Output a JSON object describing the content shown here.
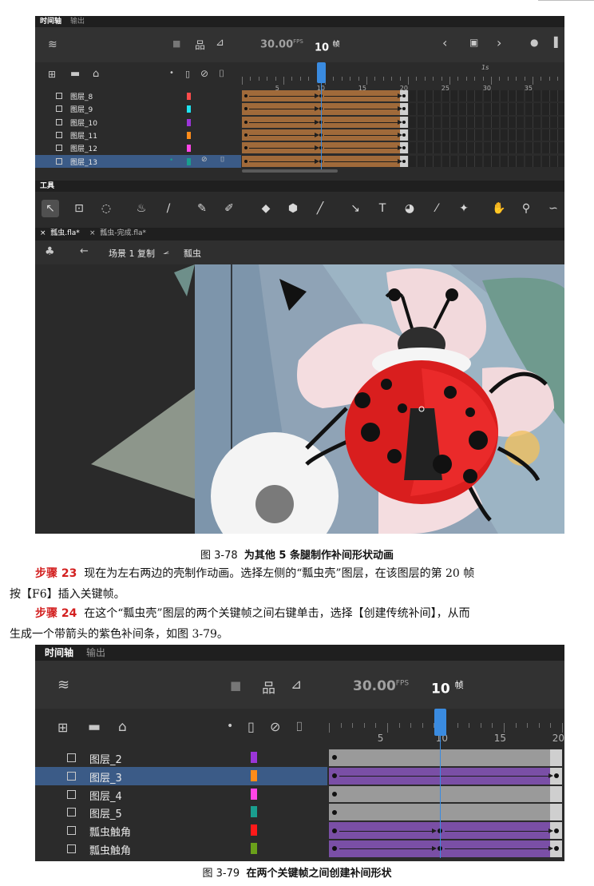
{
  "screen1": {
    "tabs": [
      "时间轴",
      "输出"
    ],
    "fps_value": "30.00",
    "fps_unit": "FPS",
    "frame_value": "10",
    "frame_unit": "帧",
    "ruler_second_label": "1s",
    "ruler_labels": [
      "5",
      "10",
      "15",
      "20",
      "25",
      "30",
      "35"
    ],
    "layers": [
      {
        "name": "图层_8",
        "color": "#ff4b4b"
      },
      {
        "name": "图层_9",
        "color": "#1ee3f0"
      },
      {
        "name": "图层_10",
        "color": "#9b35d8"
      },
      {
        "name": "图层_11",
        "color": "#ff8c1a"
      },
      {
        "name": "图层_12",
        "color": "#ff45e6"
      },
      {
        "name": "图层_13",
        "color": "#1a9e8e"
      }
    ],
    "tools_label": "工具",
    "doc_tabs": [
      "瓢虫.fla*",
      "瓢虫-完成.fla*"
    ],
    "breadcrumb": {
      "scene": "场景 1 复制",
      "symbol": "瓢虫"
    }
  },
  "caption1": {
    "number": "图 3-78",
    "text": "为其他 5 条腿制作补间形状动画"
  },
  "step23": {
    "label": "步骤 23",
    "line1": "现在为左右两边的壳制作动画。选择左侧的“瓢虫壳”图层，在该图层的第 20 帧",
    "line2": "按【F6】插入关键帧。"
  },
  "step24": {
    "label": "步骤 24",
    "line1": "在这个“瓢虫壳”图层的两个关键帧之间右键单击，选择【创建传统补间】，从而",
    "line2": "生成一个带箭头的紫色补间条，如图 3-79。"
  },
  "screen2": {
    "tabs": [
      "时间轴",
      "输出"
    ],
    "fps_value": "30.00",
    "fps_unit": "FPS",
    "frame_value": "10",
    "frame_unit": "帧",
    "ruler_labels": [
      "5",
      "10",
      "15",
      "20"
    ],
    "layers": [
      {
        "name": "图层_2",
        "color": "#9b35d8",
        "tween": false
      },
      {
        "name": "图层_3",
        "color": "#ff8c1a",
        "tween": true
      },
      {
        "name": "图层_4",
        "color": "#ff45e6",
        "tween": false
      },
      {
        "name": "图层_5",
        "color": "#1a9e8e",
        "tween": false
      },
      {
        "name": "瓢虫触角",
        "color": "#ff1a1a",
        "tween": true
      },
      {
        "name": "瓢虫触角",
        "color": "#6aa01a",
        "tween": true
      }
    ]
  },
  "caption2": {
    "number": "图 3-79",
    "text": "在两个关键帧之间创建补间形状"
  },
  "colors": {
    "panel": "#2b2b2b",
    "shape_tween": "#a06a3a",
    "classic_tween": "#7a4fa6",
    "static_frames": "#9a9a9a",
    "selected_layer": "#3b5b87",
    "playhead": "#3a8be0",
    "step_label": "#d32020"
  }
}
